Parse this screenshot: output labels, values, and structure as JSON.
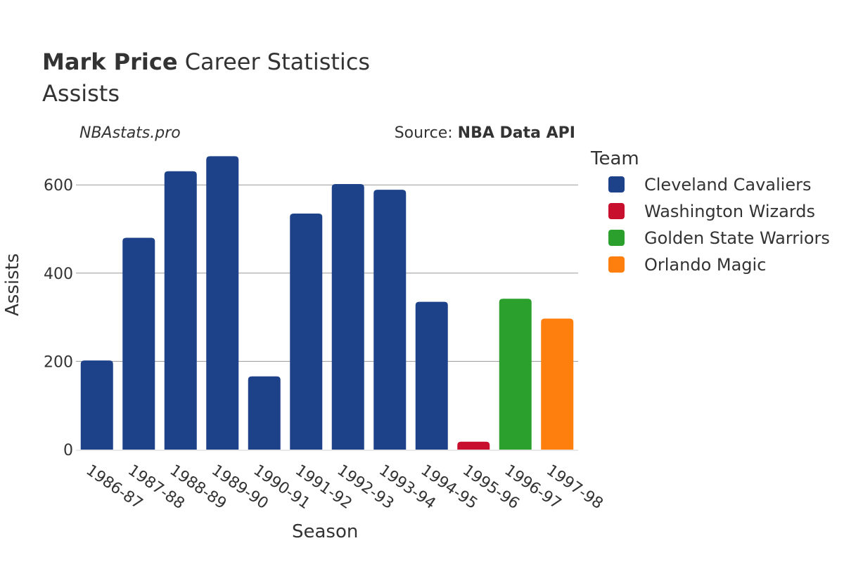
{
  "chart_data": {
    "type": "bar",
    "title_bold": "Mark Price",
    "title_rest": " Career Statistics",
    "subtitle": "Assists",
    "watermark": "NBAstats.pro",
    "source_prefix": "Source: ",
    "source_bold": "NBA Data API",
    "xlabel": "Season",
    "ylabel": "Assists",
    "ylim": [
      0,
      700
    ],
    "yticks": [
      0,
      200,
      400,
      600
    ],
    "grid": true,
    "legend_title": "Team",
    "legend_position": "right",
    "teams": [
      {
        "name": "Cleveland Cavaliers",
        "color": "#1d428a"
      },
      {
        "name": "Washington Wizards",
        "color": "#c8102e"
      },
      {
        "name": "Golden State Warriors",
        "color": "#2ca02c"
      },
      {
        "name": "Orlando Magic",
        "color": "#ff7f0e"
      }
    ],
    "categories": [
      "1986-87",
      "1987-88",
      "1988-89",
      "1989-90",
      "1990-91",
      "1991-92",
      "1992-93",
      "1993-94",
      "1994-95",
      "1995-96",
      "1996-97",
      "1997-98"
    ],
    "values": [
      202,
      480,
      631,
      665,
      166,
      535,
      602,
      589,
      335,
      18,
      342,
      297
    ],
    "bar_team": [
      "Cleveland Cavaliers",
      "Cleveland Cavaliers",
      "Cleveland Cavaliers",
      "Cleveland Cavaliers",
      "Cleveland Cavaliers",
      "Cleveland Cavaliers",
      "Cleveland Cavaliers",
      "Cleveland Cavaliers",
      "Cleveland Cavaliers",
      "Washington Wizards",
      "Golden State Warriors",
      "Orlando Magic"
    ]
  }
}
